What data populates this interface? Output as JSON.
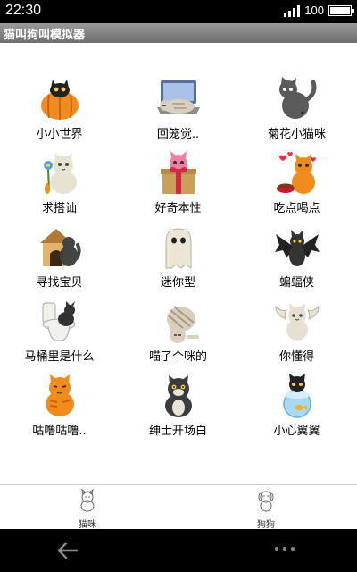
{
  "status_bar": {
    "time": "22:30",
    "battery": "100",
    "battery_level": 1.0
  },
  "app": {
    "title": "猫叫狗叫模拟器"
  },
  "grid": {
    "items": [
      {
        "label": "小小世界",
        "icon": "cat-in-pumpkin-icon"
      },
      {
        "label": "回笼觉..",
        "icon": "cat-sleeping-on-laptop-icon"
      },
      {
        "label": "菊花小猫咪",
        "icon": "cat-rear-view-icon"
      },
      {
        "label": "求搭讪",
        "icon": "cat-with-flower-icon"
      },
      {
        "label": "好奇本性",
        "icon": "cat-in-gift-box-icon"
      },
      {
        "label": "吃点喝点",
        "icon": "cat-with-food-bowl-icon"
      },
      {
        "label": "寻找宝贝",
        "icon": "cat-at-doghouse-icon"
      },
      {
        "label": "迷你型",
        "icon": "cat-ghost-costume-icon"
      },
      {
        "label": "蝙蝠侠",
        "icon": "cat-bat-wings-icon"
      },
      {
        "label": "马桶里是什么",
        "icon": "cat-on-toilet-icon"
      },
      {
        "label": "喵了个咪的",
        "icon": "cat-stretching-icon"
      },
      {
        "label": "你懂得",
        "icon": "cat-angel-wings-icon"
      },
      {
        "label": "咕噜咕噜..",
        "icon": "cat-sitting-orange-icon"
      },
      {
        "label": "绅士开场白",
        "icon": "cat-gentleman-icon"
      },
      {
        "label": "小心翼翼",
        "icon": "cat-with-fishbowl-icon"
      }
    ]
  },
  "tabs": [
    {
      "label": "猫咪",
      "icon": "cat-tab-icon"
    },
    {
      "label": "狗狗",
      "icon": "dog-tab-icon"
    }
  ],
  "nav": {
    "back_icon": "back-arrow-icon",
    "more_icon": "more-dots-icon"
  }
}
